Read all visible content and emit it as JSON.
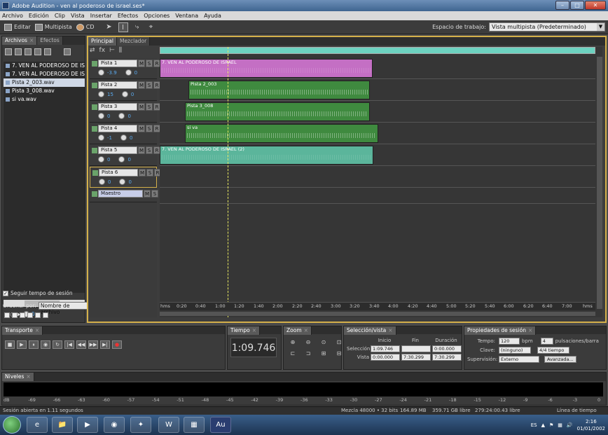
{
  "window": {
    "title": "Adobe Audition - ven al poderoso de israel.ses*"
  },
  "menu": [
    "Archivo",
    "Edición",
    "Clip",
    "Vista",
    "Insertar",
    "Efectos",
    "Opciones",
    "Ventana",
    "Ayuda"
  ],
  "toolbar": {
    "edit_label": "Editar",
    "multitrack_label": "Multipista",
    "cd_label": "CD",
    "workspace_label": "Espacio de trabajo:",
    "workspace_value": "Vista multipista (Predeterminado)"
  },
  "files_panel": {
    "tabs": [
      "Archivos",
      "Efectos"
    ],
    "files": [
      "7. VEN AL PODEROSO DE ISRAEL",
      "7. VEN AL PODEROSO DE ISRAEL",
      "Pista 2_003.wav",
      "Pista 3_008.wav",
      "si va.wav"
    ],
    "follow_time_label": "Seguir tempo de sesión",
    "sort_label": "Ordenar por:",
    "sort_value": "Nombre de archivo",
    "knob_value": "0"
  },
  "editor": {
    "tabs": [
      "Principal",
      "Mezclador"
    ],
    "tracks": [
      {
        "name": "Pista 1",
        "vol": "-3.9",
        "pan": "0"
      },
      {
        "name": "Pista 2",
        "vol": "15",
        "pan": "0"
      },
      {
        "name": "Pista 3",
        "vol": "0",
        "pan": "0"
      },
      {
        "name": "Pista 4",
        "vol": "-1",
        "pan": "0"
      },
      {
        "name": "Pista 5",
        "vol": "0",
        "pan": "0"
      },
      {
        "name": "Pista 6",
        "vol": "0",
        "pan": "0"
      },
      {
        "name": "Maestro",
        "vol": "",
        "pan": ""
      }
    ],
    "btn_m": "M",
    "btn_s": "S",
    "btn_r": "R",
    "clips": [
      {
        "label": "7. VEN AL PODEROSO DE ISRAEL",
        "color": "#c46fc4"
      },
      {
        "label": "Pista 2_003",
        "color": "#3f8a3f"
      },
      {
        "label": "Pista 3_008",
        "color": "#3f8a3f"
      },
      {
        "label": "si va",
        "color": "#3f8a3f"
      },
      {
        "label": "7. VEN AL PODEROSO DE ISRAEL (2)",
        "color": "#5bb59b"
      }
    ],
    "ruler": [
      "hms",
      "0:20",
      "0:40",
      "1:00",
      "1:20",
      "1:40",
      "2:00",
      "2:20",
      "2:40",
      "3:00",
      "3:20",
      "3:40",
      "4:00",
      "4:20",
      "4:40",
      "5:00",
      "5:20",
      "5:40",
      "6:00",
      "6:20",
      "6:40",
      "7:00",
      "hms"
    ]
  },
  "transport": {
    "tab": "Transporte",
    "buttons": [
      "■",
      "▶",
      "⏸",
      "◉",
      "↻",
      "|◀",
      "◀◀",
      "▶▶",
      "▶|",
      "●"
    ]
  },
  "time_panel": {
    "tab": "Tiempo",
    "value": "1:09.746"
  },
  "zoom_panel": {
    "tab": "Zoom"
  },
  "selection_panel": {
    "tab": "Selección/vista",
    "col_start": "Inicio",
    "col_end": "Fin",
    "col_duration": "Duración",
    "sel_label": "Selección",
    "sel_start": "1:09.746",
    "sel_end": "",
    "sel_duration": "0:00.000",
    "view_label": "Vista",
    "view_start": "0:00.000",
    "view_end": "7:30.299",
    "view_duration": "7:30.299"
  },
  "session_props": {
    "tab": "Propiedades de sesión",
    "tempo_label": "Tempo:",
    "tempo_value": "120",
    "tempo_unit": "bpm",
    "beats_value": "4",
    "beats_label": "pulsaciones/barra",
    "key_label": "Clave:",
    "key_value": "(ninguno)",
    "time_sig": "4/4 tiempo",
    "monitor_label": "Supervisión:",
    "monitor_value": "Externo",
    "advanced_label": "Avanzada..."
  },
  "levels": {
    "tab": "Niveles",
    "scale": [
      "dB",
      "-69",
      "-66",
      "-63",
      "-60",
      "-57",
      "-54",
      "-51",
      "-48",
      "-45",
      "-42",
      "-39",
      "-36",
      "-33",
      "-30",
      "-27",
      "-24",
      "-21",
      "-18",
      "-15",
      "-12",
      "-9",
      "-6",
      "-3",
      "0"
    ]
  },
  "status": {
    "session_open": "Sesión abierta en 1.11 segundos",
    "mix_format": "Mezcla 48000 • 32 bits",
    "mem": "164.89 MB",
    "disk": "359.71 GB libre",
    "time_free": "279:24:00.43 libre",
    "view": "Línea de tiempo"
  },
  "taskbar": {
    "lang": "ES",
    "time": "2:16",
    "date": "01/01/2002",
    "apps": [
      "e",
      "📁",
      "▶",
      "◉",
      "✦",
      "W",
      "▦",
      "Au"
    ]
  }
}
